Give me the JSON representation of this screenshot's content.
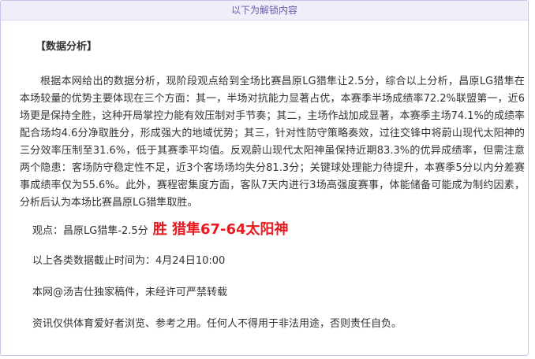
{
  "banner": {
    "text": "以下为解锁内容"
  },
  "analysis": {
    "title": "【数据分析】",
    "paragraph": "根据本网给出的数据分析，现阶段观点给到全场比赛昌原LG猎隼让2.5分，综合以上分析，昌原LG猎隼在本场较量的优势主要体现在三个方面：其一，半场对抗能力显著占优，本赛季半场成绩率72.2%联盟第一，近6场更是保持全胜，这种开局掌控力能有效压制对手节奏；其二，主场作战加成显著，本赛季主场74.1%的成绩率配合场均4.6分净取胜分，形成强大的地域优势；其三，针对性防守策略奏效，过往交锋中将蔚山现代太阳神的三分效率压制至31.6%，低于其赛季平均值。反观蔚山现代太阳神虽保持近期83.3%的优异成绩率，但需注意两个隐患：客场防守稳定性不足，近3个客场场均失分81.3分；关键球处理能力待提升，本赛季5分以内分差赛事成绩率仅为55.6%。此外，赛程密集度方面，客队7天内进行3场高强度赛事，体能储备可能成为制约因素，分析后认为本场比赛昌原LG猎隼取胜。"
  },
  "viewpoint": {
    "label": "观点：昌原LG猎隼-2.5分",
    "result": "胜  猎隼67-64太阳神",
    "result_color": "#e8191f"
  },
  "footer": {
    "data_cutoff": "以上各类数据截止时间为：4月24日10:00",
    "copyright": "本网@汤吉仕独家稿件，未经许可严禁转载",
    "disclaimer": "资讯仅供体育爱好者浏览、参考之用。任何人不得用于非法用途，否则责任自负。"
  }
}
